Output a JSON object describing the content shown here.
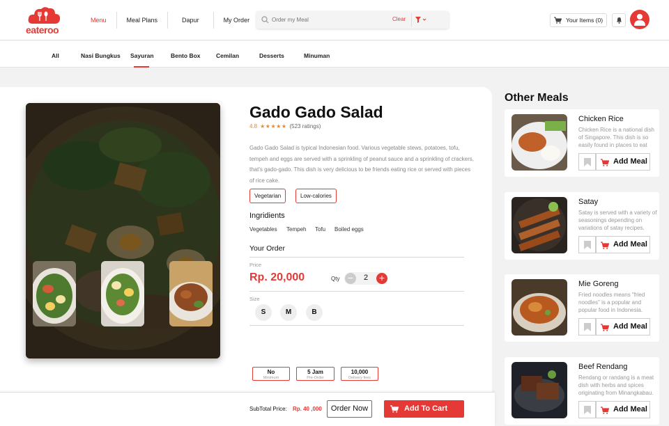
{
  "brand": {
    "name": "eateroo",
    "color": "#e53935"
  },
  "nav": {
    "items": [
      "Menu",
      "Meal Plans",
      "Dapur",
      "My Order"
    ],
    "active": "Menu"
  },
  "search": {
    "placeholder": "Order my Meal",
    "clear": "Clear"
  },
  "cart": {
    "label": "Your Items (0)"
  },
  "categories": {
    "items": [
      "All",
      "Nasi Bungkus",
      "Sayuran",
      "Bento Box",
      "Cemilan",
      "Desserts",
      "Minuman"
    ],
    "active": "Sayuran"
  },
  "product": {
    "title": "Gado Gado Salad",
    "rating": "4.8",
    "stars": "★★★★★",
    "ratings_count": "(523 ratings)",
    "description": "Gado Gado Salad is typical Indonesian food. Various vegetable stews, potatoes, tofu, tempeh and eggs are served with a sprinkling of peanut sauce and a sprinkling of crackers, that's gado-gado. This dish is very delicious to be friends eating rice or served with pieces of rice cake.",
    "tags": [
      "Vegetarian",
      "Low-calories"
    ],
    "ingredients_title": "Ingridients",
    "ingredients": [
      "Vegetables",
      "Tempeh",
      "Tofu",
      "Boiled eggs"
    ]
  },
  "order": {
    "title": "Your Order",
    "price_label": "Price",
    "price": "Rp. 20,000",
    "qty_label": "Qty",
    "qty": "2",
    "size_label": "Size",
    "sizes": [
      "S",
      "M",
      "B"
    ]
  },
  "info": [
    {
      "value": "No",
      "label": "Minimum"
    },
    {
      "value": "5 Jam",
      "label": "Pre-Order"
    },
    {
      "value": "10,000",
      "label": "Delivery fees"
    }
  ],
  "bottom": {
    "subtotal_label": "SubTotal Price:",
    "subtotal_value": "Rp. 40 ,000",
    "order_now": "Order Now",
    "add_to_cart": "Add To Cart"
  },
  "other": {
    "title": "Other Meals",
    "add_label": "Add Meal",
    "meals": [
      {
        "name": "Chicken Rice",
        "desc": "Chicken Rice is a national dish of Singapore. This dish is so easily found in places to eat"
      },
      {
        "name": "Satay",
        "desc": "Satay is served with a variety of seasonings depending on variations of satay recipes."
      },
      {
        "name": "Mie Goreng",
        "desc": "Fried noodles means \"fried noodles\" is a popular and popular food in Indonesia."
      },
      {
        "name": "Beef Rendang",
        "desc": "Rendang or randang is a meat dish with herbs and spices originating from Minangkabau."
      }
    ]
  }
}
